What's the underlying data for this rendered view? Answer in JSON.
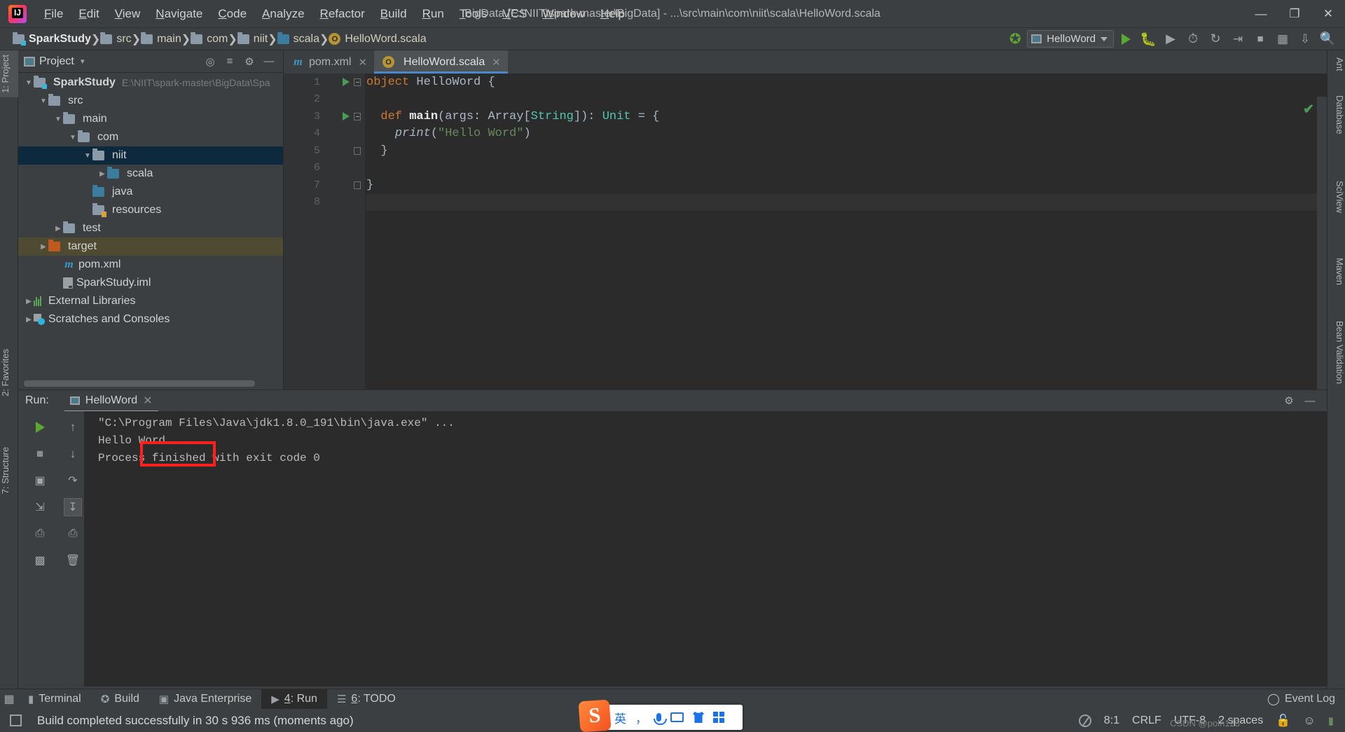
{
  "window": {
    "title": "BigData [E:\\NIIT\\spark-master\\BigData] - ...\\src\\main\\com\\niit\\scala\\HelloWord.scala",
    "minimize": "—",
    "maximize": "❐",
    "close": "✕"
  },
  "menu": [
    "File",
    "Edit",
    "View",
    "Navigate",
    "Code",
    "Analyze",
    "Refactor",
    "Build",
    "Run",
    "Tools",
    "VCS",
    "Window",
    "Help"
  ],
  "breadcrumb": [
    {
      "label": "SparkStudy",
      "icon": "module-folder-icon",
      "bold": true
    },
    {
      "label": "src",
      "icon": "folder-icon",
      "bold": false
    },
    {
      "label": "main",
      "icon": "folder-icon",
      "bold": false
    },
    {
      "label": "com",
      "icon": "folder-icon",
      "bold": false
    },
    {
      "label": "niit",
      "icon": "folder-icon",
      "bold": false
    },
    {
      "label": "scala",
      "icon": "source-folder-icon",
      "bold": false
    },
    {
      "label": "HelloWord.scala",
      "icon": "scala-object-icon",
      "bold": false
    }
  ],
  "navbar": {
    "build_icon": "hammer-icon",
    "run_config": "HelloWord",
    "run_icon": "run-icon",
    "debug_icon": "debug-icon",
    "coverage_icon": "run-coverage-icon",
    "profile_icon": "profiler-icon",
    "rerun_icon": "rerun-icon",
    "stop_icon": "stop-icon",
    "layout_icon": "layout-icon",
    "updates_icon": "update-project-icon",
    "search_icon": "search-everywhere-icon"
  },
  "left_strip": [
    {
      "label": "1: Project",
      "active": true
    },
    {
      "label": "2: Favorites",
      "active": false
    },
    {
      "label": "7: Structure",
      "active": false
    }
  ],
  "right_strip": [
    {
      "label": "Ant"
    },
    {
      "label": "Database"
    },
    {
      "label": "SciView"
    },
    {
      "label": "Maven"
    },
    {
      "label": "Bean Validation"
    }
  ],
  "project_panel": {
    "title": "Project",
    "caret": "▾",
    "tools": [
      "locate-icon",
      "collapse-all-icon",
      "settings-icon",
      "hide-icon"
    ],
    "tree": [
      {
        "depth": 0,
        "arrow": "▼",
        "icon": "module-folder-icon",
        "label": "SparkStudy",
        "bold": true,
        "path": "E:\\NIIT\\spark-master\\BigData\\Spa",
        "state": "normal"
      },
      {
        "depth": 1,
        "arrow": "▼",
        "icon": "folder-icon",
        "label": "src",
        "bold": false,
        "path": "",
        "state": "normal"
      },
      {
        "depth": 2,
        "arrow": "▼",
        "icon": "folder-icon",
        "label": "main",
        "bold": false,
        "path": "",
        "state": "normal"
      },
      {
        "depth": 3,
        "arrow": "▼",
        "icon": "folder-icon",
        "label": "com",
        "bold": false,
        "path": "",
        "state": "normal"
      },
      {
        "depth": 4,
        "arrow": "▼",
        "icon": "folder-icon",
        "label": "niit",
        "bold": false,
        "path": "",
        "state": "selected"
      },
      {
        "depth": 5,
        "arrow": "▶",
        "icon": "source-folder-icon",
        "label": "scala",
        "bold": false,
        "path": "",
        "state": "normal"
      },
      {
        "depth": 4,
        "arrow": "",
        "icon": "source-folder-icon",
        "label": "java",
        "bold": false,
        "path": "",
        "state": "normal"
      },
      {
        "depth": 4,
        "arrow": "",
        "icon": "resources-folder-icon",
        "label": "resources",
        "bold": false,
        "path": "",
        "state": "normal"
      },
      {
        "depth": 2,
        "arrow": "▶",
        "icon": "folder-icon",
        "label": "test",
        "bold": false,
        "path": "",
        "state": "normal"
      },
      {
        "depth": 1,
        "arrow": "▶",
        "icon": "excluded-folder-icon",
        "label": "target",
        "bold": false,
        "path": "",
        "state": "target"
      },
      {
        "depth": 2,
        "arrow": "",
        "icon": "maven-file-icon",
        "label": "pom.xml",
        "bold": false,
        "path": "",
        "state": "normal"
      },
      {
        "depth": 2,
        "arrow": "",
        "icon": "iml-file-icon",
        "label": "SparkStudy.iml",
        "bold": false,
        "path": "",
        "state": "normal"
      },
      {
        "depth": 0,
        "arrow": "▶",
        "icon": "external-libraries-icon",
        "label": "External Libraries",
        "bold": false,
        "path": "",
        "state": "normal"
      },
      {
        "depth": 0,
        "arrow": "▶",
        "icon": "scratches-icon",
        "label": "Scratches and Consoles",
        "bold": false,
        "path": "",
        "state": "normal"
      }
    ]
  },
  "editor": {
    "tabs": [
      {
        "label": "pom.xml",
        "icon": "maven-file-icon",
        "active": false,
        "close": "✕"
      },
      {
        "label": "HelloWord.scala",
        "icon": "scala-object-icon",
        "active": true,
        "close": "✕"
      }
    ],
    "inspection_status": "✔",
    "line_numbers": [
      "1",
      "2",
      "3",
      "4",
      "5",
      "6",
      "7",
      "8"
    ],
    "lines": [
      {
        "n": 1,
        "indent": 0,
        "tokens": [
          {
            "t": "object ",
            "c": "kw"
          },
          {
            "t": "HelloWord {",
            "c": "plain"
          }
        ],
        "gutter_run": true,
        "fold": "open"
      },
      {
        "n": 2,
        "indent": 0,
        "tokens": [],
        "gutter_run": false,
        "fold": ""
      },
      {
        "n": 3,
        "indent": 1,
        "tokens": [
          {
            "t": "def ",
            "c": "kw"
          },
          {
            "t": "main",
            "c": "fnb"
          },
          {
            "t": "(args: Array[",
            "c": "plain"
          },
          {
            "t": "String",
            "c": "ty"
          },
          {
            "t": "]): ",
            "c": "plain"
          },
          {
            "t": "Unit",
            "c": "ty"
          },
          {
            "t": " = {",
            "c": "plain"
          }
        ],
        "gutter_run": true,
        "fold": "open"
      },
      {
        "n": 4,
        "indent": 2,
        "tokens": [
          {
            "t": "print",
            "c": "it"
          },
          {
            "t": "(",
            "c": "plain"
          },
          {
            "t": "\"Hello Word\"",
            "c": "str"
          },
          {
            "t": ")",
            "c": "plain"
          }
        ],
        "gutter_run": false,
        "fold": ""
      },
      {
        "n": 5,
        "indent": 1,
        "tokens": [
          {
            "t": "}",
            "c": "plain"
          }
        ],
        "gutter_run": false,
        "fold": "close"
      },
      {
        "n": 6,
        "indent": 0,
        "tokens": [],
        "gutter_run": false,
        "fold": ""
      },
      {
        "n": 7,
        "indent": 0,
        "tokens": [
          {
            "t": "}",
            "c": "plain"
          }
        ],
        "gutter_run": false,
        "fold": "close"
      },
      {
        "n": 8,
        "indent": 0,
        "tokens": [],
        "gutter_run": false,
        "fold": ""
      }
    ]
  },
  "run_panel": {
    "label": "Run:",
    "tab": "HelloWord",
    "tab_close": "✕",
    "settings_icon": "gear-icon",
    "hide_icon": "hide-icon",
    "toolbar": [
      "rerun-icon",
      "stop-icon",
      "camera-icon",
      "export-icon",
      "print-icon",
      "trash-icon"
    ],
    "toolbar2": [
      "scroll-up-icon",
      "scroll-down-icon",
      "soft-wrap-icon",
      "scroll-to-end-icon",
      "print-icon",
      "trash-icon"
    ],
    "console": [
      "\"C:\\Program Files\\Java\\jdk1.8.0_191\\bin\\java.exe\" ...",
      "Hello Word",
      "Process finished with exit code 0"
    ],
    "highlight_box_color": "#ff2020"
  },
  "bottom_bar": {
    "items": [
      {
        "label": "Terminal",
        "icon": "terminal-icon",
        "num": "",
        "active": false
      },
      {
        "label": "Build",
        "icon": "build-icon",
        "num": "",
        "active": false
      },
      {
        "label": "Java Enterprise",
        "icon": "java-ee-icon",
        "num": "",
        "active": false
      },
      {
        "label": "Run",
        "icon": "run-icon",
        "num": "4",
        "active": true
      },
      {
        "label": "TODO",
        "icon": "todo-icon",
        "num": "6",
        "active": false
      }
    ],
    "event_log": "Event Log",
    "event_log_icon": "event-log-icon"
  },
  "status_bar": {
    "message": "Build completed successfully in 30 s 936 ms (moments ago)",
    "book_icon": "show-log-icon",
    "caret_position": "8:1",
    "line_separator": "CRLF",
    "encoding": "UTF-8",
    "indent": "2 spaces",
    "lock_icon": "unlock-icon",
    "inspector_icon": "hector-icon",
    "memory_icon": "memory-indicator-icon",
    "clock_icon": "progress-icon"
  },
  "ime": {
    "logo": "S",
    "items": [
      "英",
      "，",
      "mic-icon",
      "keyboard-icon",
      "skin-icon",
      "apps-icon"
    ]
  },
  "watermark": "CSDN @polh123",
  "colors": {
    "accent": "#4a88c7",
    "run_green": "#5aa832",
    "selection": "#0d293e",
    "panel_bg": "#3c3f41",
    "editor_bg": "#2b2b2b"
  }
}
